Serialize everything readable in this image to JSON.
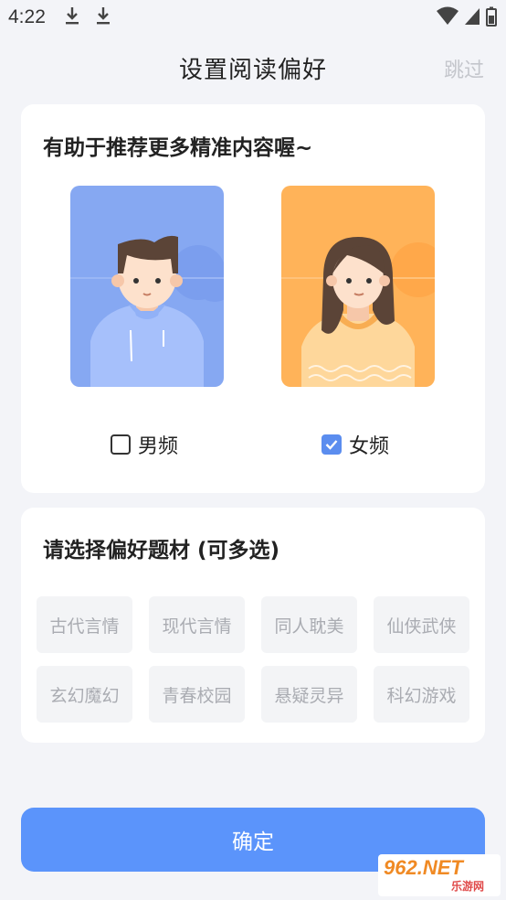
{
  "status_bar": {
    "time": "4:22"
  },
  "header": {
    "title": "设置阅读偏好",
    "skip": "跳过"
  },
  "gender_card": {
    "title": "有助于推荐更多精准内容喔~",
    "male_label": "男频",
    "female_label": "女频",
    "male_checked": false,
    "female_checked": true
  },
  "topics_card": {
    "title": "请选择偏好题材 (可多选)",
    "tags": [
      "古代言情",
      "现代言情",
      "同人耽美",
      "仙侠武侠",
      "玄幻魔幻",
      "青春校园",
      "悬疑灵异",
      "科幻游戏"
    ]
  },
  "confirm_label": "确定",
  "watermark": {
    "main": "962.NET",
    "sub": "乐游网"
  },
  "colors": {
    "accent": "#5b94fb",
    "male_bg": "#86a8f2",
    "female_bg": "#ffb359"
  }
}
